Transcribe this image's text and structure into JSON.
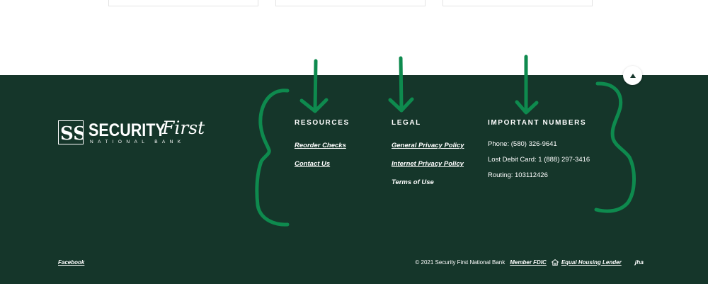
{
  "resources": {
    "heading": "RESOURCES",
    "links": [
      "Reorder Checks",
      "Contact Us"
    ]
  },
  "legal": {
    "heading": "LEGAL",
    "links": [
      "General Privacy Policy",
      "Internet Privacy Policy",
      "Terms of Use"
    ]
  },
  "numbers": {
    "heading": "IMPORTANT NUMBERS",
    "lines": [
      "Phone: (580) 326-9641",
      "Lost Debit Card: 1 (888) 297-3416",
      "Routing: 103112426"
    ]
  },
  "logo": {
    "monogram": "SS",
    "word": "SECURITY",
    "script": "First",
    "sub": "NATIONAL BANK"
  },
  "bottom": {
    "facebook": "Facebook",
    "copyright": "© 2021 Security First National Bank",
    "member_fdic": "Member FDIC",
    "equal_housing": "Equal Housing Lender",
    "jha": "jha"
  },
  "colors": {
    "footer_bg": "#15362a",
    "annotation": "#0e8a4e"
  },
  "icons": {
    "back_to_top": "chevron-up-icon",
    "equal_housing": "house-icon"
  }
}
